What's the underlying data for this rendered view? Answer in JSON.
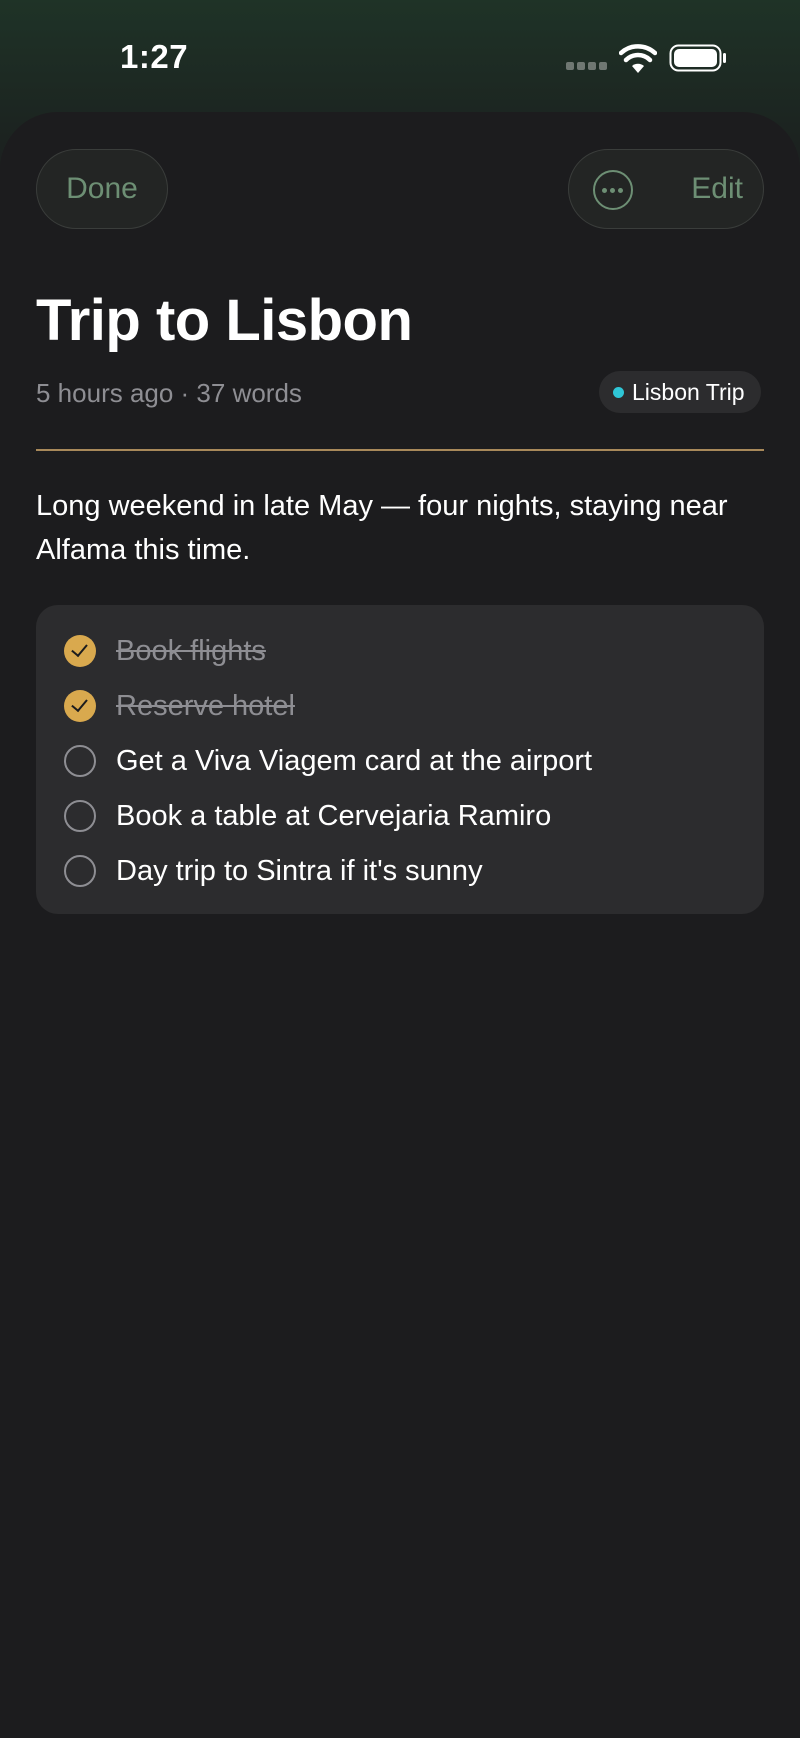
{
  "status_bar": {
    "time": "1:27",
    "icons": [
      "signal-icon",
      "wifi-icon",
      "battery-icon"
    ]
  },
  "toolbar": {
    "done_label": "Done",
    "more_icon": "ellipsis-circle-icon",
    "edit_label": "Edit"
  },
  "note": {
    "title": "Trip to Lisbon",
    "meta": "5 hours ago · 37 words",
    "tag": {
      "label": "Lisbon Trip",
      "color": "#2fc6d6"
    },
    "body": "Long weekend in late May — four nights, staying near Alfama this time.",
    "checklist": [
      {
        "text": "Book flights",
        "checked": true
      },
      {
        "text": "Reserve hotel",
        "checked": true
      },
      {
        "text": "Get a Viva Viagem card at the airport",
        "checked": false
      },
      {
        "text": "Book a table at Cervejaria Ramiro",
        "checked": false
      },
      {
        "text": "Day trip to Sintra if it's sunny",
        "checked": false
      }
    ]
  },
  "colors": {
    "accent_green": "#6d8f74",
    "check_gold": "#d9a94e",
    "divider": "#a8895a",
    "background": "#1c1c1e"
  }
}
